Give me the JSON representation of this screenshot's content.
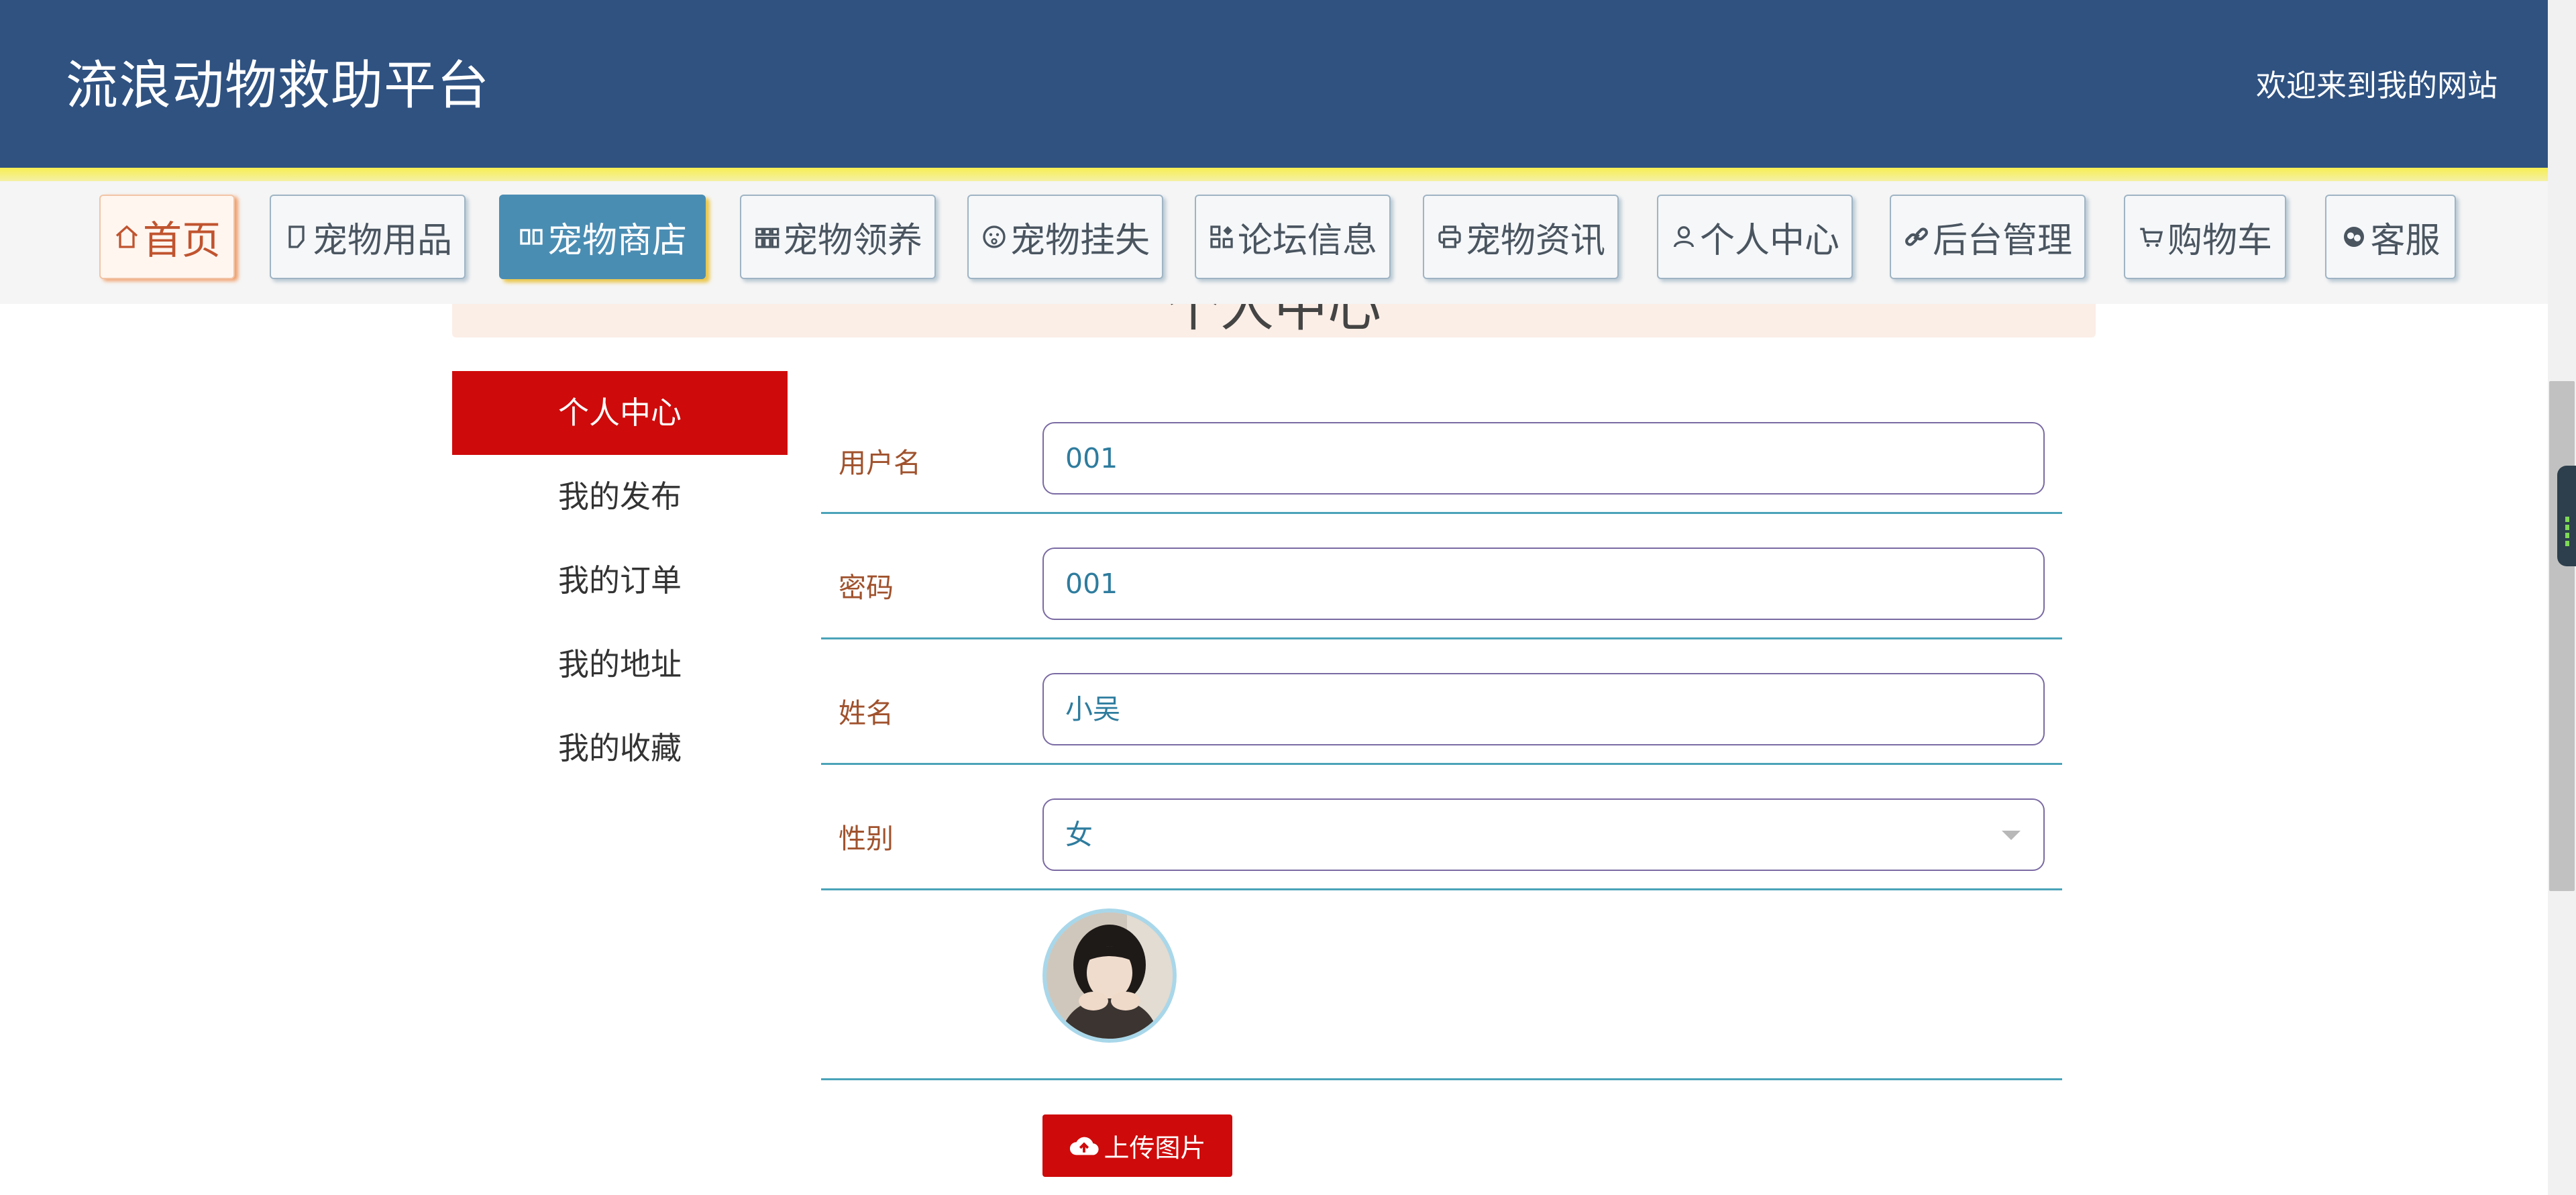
{
  "header": {
    "brand": "流浪动物救助平台",
    "welcome": "欢迎来到我的网站"
  },
  "nav": {
    "items": [
      {
        "label": "首页",
        "icon": "home-icon"
      },
      {
        "label": "宠物用品",
        "icon": "document-icon"
      },
      {
        "label": "宠物商店",
        "icon": "grid-icon"
      },
      {
        "label": "宠物领养",
        "icon": "grid-icon"
      },
      {
        "label": "宠物挂失",
        "icon": "smile-icon"
      },
      {
        "label": "论坛信息",
        "icon": "apps-icon"
      },
      {
        "label": "宠物资讯",
        "icon": "printer-icon"
      },
      {
        "label": "个人中心",
        "icon": "user-icon"
      },
      {
        "label": "后台管理",
        "icon": "link-icon"
      },
      {
        "label": "购物车",
        "icon": "cart-icon"
      },
      {
        "label": "客服",
        "icon": "chat-icon"
      }
    ],
    "active": "宠物商店"
  },
  "section": {
    "title": "个人中心"
  },
  "sidebar": {
    "items": [
      {
        "label": "个人中心"
      },
      {
        "label": "我的发布"
      },
      {
        "label": "我的订单"
      },
      {
        "label": "我的地址"
      },
      {
        "label": "我的收藏"
      }
    ]
  },
  "form": {
    "username": {
      "label": "用户名",
      "value": "001"
    },
    "password": {
      "label": "密码",
      "value": "001"
    },
    "name": {
      "label": "姓名",
      "value": "小吴"
    },
    "gender": {
      "label": "性别",
      "value": "女"
    },
    "upload_label": "上传图片"
  },
  "colors": {
    "header_bg": "#2f5281",
    "active_tab": "#4a8db3",
    "accent_red": "#cf0a0a",
    "label_brown": "#a0522d",
    "value_teal": "#2e7c9e"
  }
}
